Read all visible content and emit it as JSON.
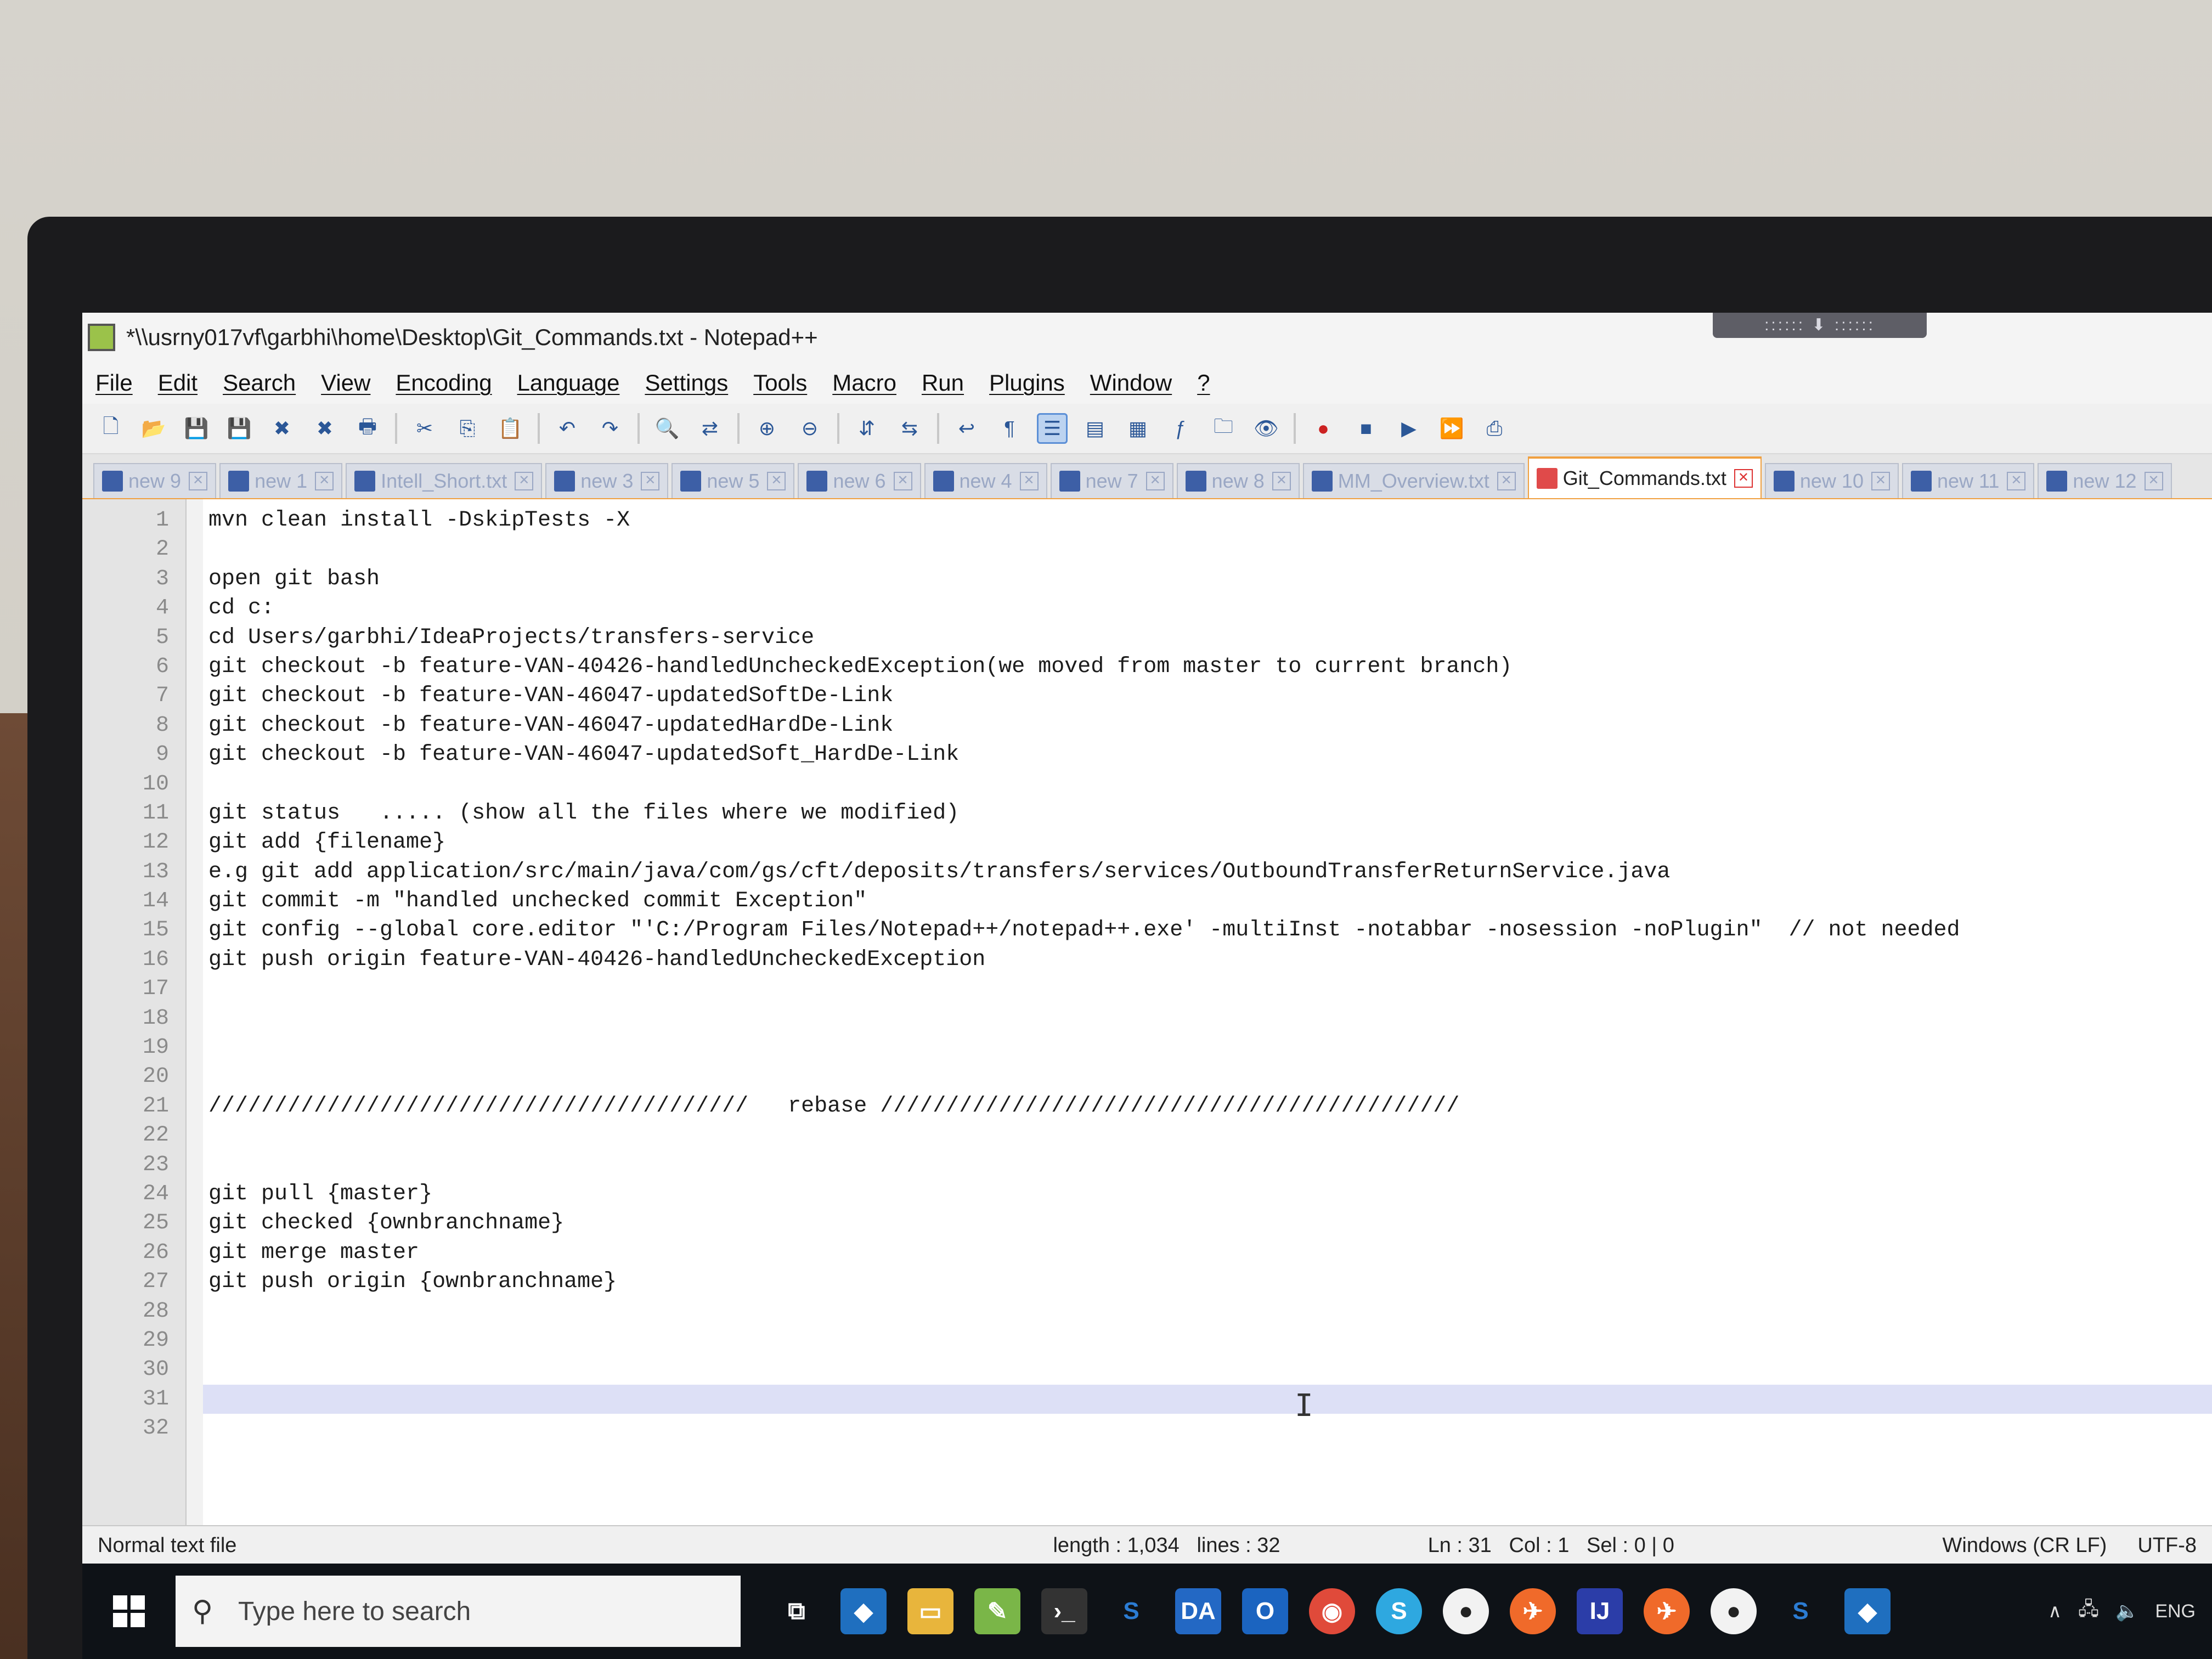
{
  "window": {
    "title": "*\\\\usrny017vf\\garbhi\\home\\Desktop\\Git_Commands.txt - Notepad++"
  },
  "menu": [
    "File",
    "Edit",
    "Search",
    "View",
    "Encoding",
    "Language",
    "Settings",
    "Tools",
    "Macro",
    "Run",
    "Plugins",
    "Window",
    "?"
  ],
  "tabs": [
    {
      "label": "new 9",
      "active": false
    },
    {
      "label": "new 1",
      "active": false
    },
    {
      "label": "Intell_Short.txt",
      "active": false
    },
    {
      "label": "new 3",
      "active": false
    },
    {
      "label": "new 5",
      "active": false
    },
    {
      "label": "new 6",
      "active": false
    },
    {
      "label": "new 4",
      "active": false
    },
    {
      "label": "new 7",
      "active": false
    },
    {
      "label": "new 8",
      "active": false
    },
    {
      "label": "MM_Overview.txt",
      "active": false
    },
    {
      "label": "Git_Commands.txt",
      "active": true
    },
    {
      "label": "new 10",
      "active": false
    },
    {
      "label": "new 11",
      "active": false
    },
    {
      "label": "new 12",
      "active": false
    }
  ],
  "editor": {
    "current_line": 31,
    "lines": [
      "mvn clean install -DskipTests -X",
      "",
      "open git bash",
      "cd c:",
      "cd Users/garbhi/IdeaProjects/transfers-service",
      "git checkout -b feature-VAN-40426-handledUncheckedException(we moved from master to current branch)",
      "git checkout -b feature-VAN-46047-updatedSoftDe-Link",
      "git checkout -b feature-VAN-46047-updatedHardDe-Link",
      "git checkout -b feature-VAN-46047-updatedSoft_HardDe-Link",
      "",
      "git status   ..... (show all the files where we modified)",
      "git add {filename}",
      "e.g git add application/src/main/java/com/gs/cft/deposits/transfers/services/OutboundTransferReturnService.java",
      "git commit -m \"handled unchecked commit Exception\"",
      "git config --global core.editor \"'C:/Program Files/Notepad++/notepad++.exe' -multiInst -notabbar -nosession -noPlugin\"  // not needed",
      "git push origin feature-VAN-40426-handledUncheckedException",
      "",
      "",
      "",
      "",
      "/////////////////////////////////////////   rebase ////////////////////////////////////////////",
      "",
      "",
      "git pull {master}",
      "git checked {ownbranchname}",
      "git merge master",
      "git push origin {ownbranchname}",
      "",
      "",
      "",
      "",
      ""
    ]
  },
  "status": {
    "file_type": "Normal text file",
    "length": "length : 1,034",
    "lines": "lines : 32",
    "ln": "Ln : 31",
    "col": "Col : 1",
    "sel": "Sel : 0 | 0",
    "eol": "Windows (CR LF)",
    "encoding": "UTF-8"
  },
  "taskbar": {
    "search_placeholder": "Type here to search",
    "tray_lang": "ENG"
  }
}
